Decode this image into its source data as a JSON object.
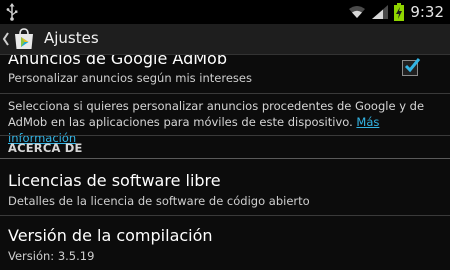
{
  "status_bar": {
    "time": "9:32",
    "icons": [
      "usb-icon",
      "wifi-icon",
      "signal-icon",
      "battery-charging-icon"
    ]
  },
  "action_bar": {
    "title": "Ajustes",
    "icons": [
      "up-chevron-icon",
      "play-store-icon"
    ]
  },
  "settings": {
    "ads_personalization": {
      "title": "Anuncios de Google AdMob",
      "summary": "Personalizar anuncios según mis intereses",
      "checked": true
    },
    "info_text": "Selecciona si quieres personalizar anuncios procedentes de Google y de AdMob en las aplicaciones para móviles de este dispositivo.",
    "info_link": "Más información",
    "section_header": "ACERCA DE",
    "open_source": {
      "title": "Licencias de software libre",
      "summary": "Detalles de la licencia de software de código abierto"
    },
    "build_version": {
      "title": "Versión de la compilación",
      "summary": "Versión: 3.5.19"
    }
  },
  "colors": {
    "accent": "#33b5e5",
    "background": "#0c0c0c",
    "battery": "#8fd400"
  }
}
